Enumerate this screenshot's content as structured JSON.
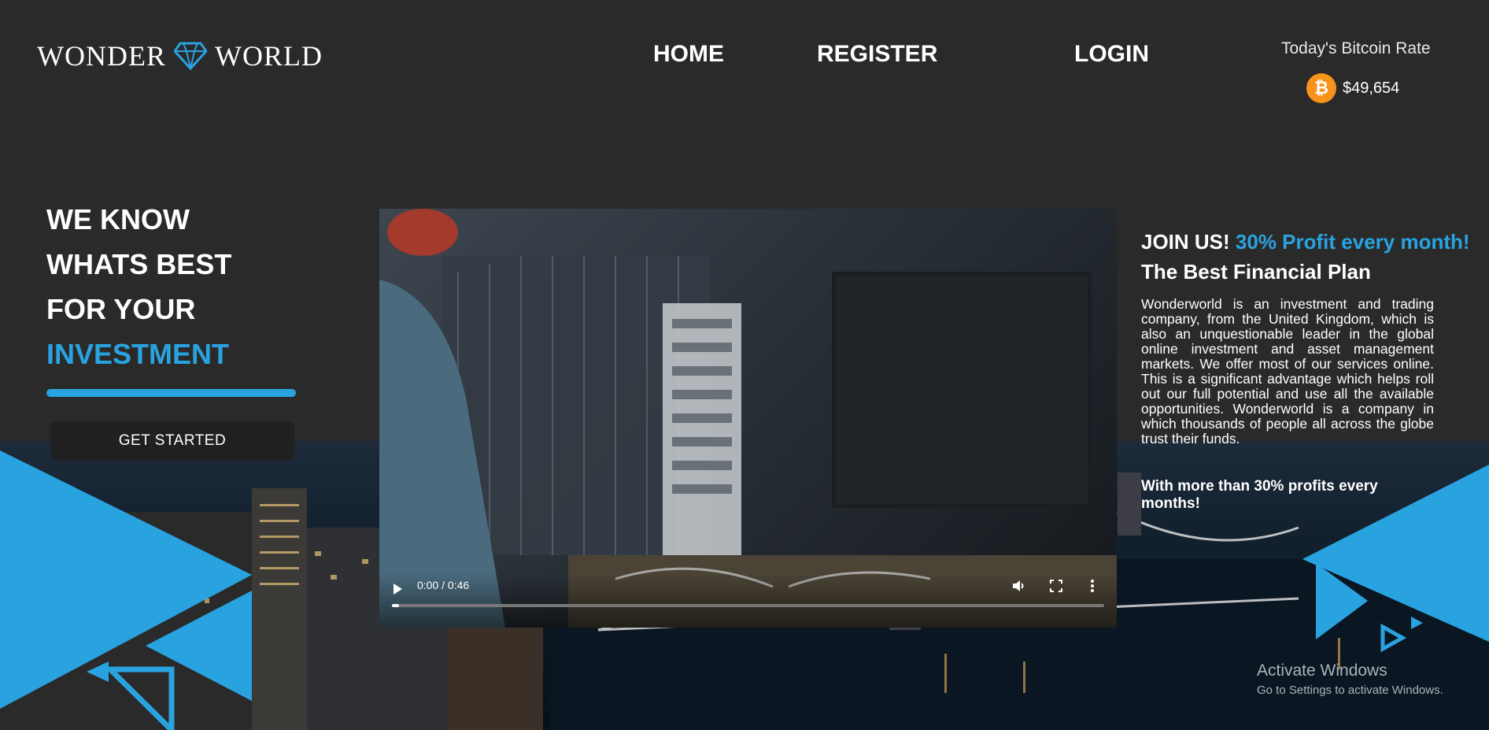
{
  "header": {
    "logo_left": "WONDER",
    "logo_right": "WORLD",
    "nav": {
      "home": "HOME",
      "register": "REGISTER",
      "login": "LOGIN"
    },
    "bitcoin": {
      "label": "Today's Bitcoin Rate",
      "value": "$49,654",
      "icon": "bitcoin-icon"
    }
  },
  "hero": {
    "lines": [
      "WE KNOW",
      "WHATS BEST",
      "FOR YOUR"
    ],
    "accent_line": "INVESTMENT",
    "cta": "GET STARTED"
  },
  "video": {
    "time": "0:00 / 0:46",
    "progress": 0.0,
    "controls": [
      "play-icon",
      "volume-icon",
      "fullscreen-icon",
      "more-options-icon"
    ]
  },
  "info": {
    "join_prefix": "JOIN US!",
    "join_accent": "30% Profit every month!",
    "plan_title": "The Best Financial Plan",
    "description": "Wonderworld is an investment and trading company, from the United Kingdom, which is also an unquestionable leader in the global online investment and asset management markets. We offer most of our services online. This is a significant advantage which helps roll out our full potential and use all the available opportunities. Wonderworld is a company in which thousands of people all across the globe trust their funds.",
    "closing": "With more than 30% profits every months!"
  },
  "os_watermark": {
    "title": "Activate Windows",
    "subtitle": "Go to Settings to activate Windows."
  },
  "colors": {
    "accent": "#29a3e0",
    "background": "#2b2a2b",
    "bitcoin": "#f7931a"
  }
}
